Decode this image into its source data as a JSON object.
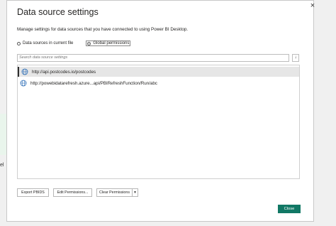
{
  "background": {
    "partial_text": "el"
  },
  "dialog": {
    "title": "Data source settings",
    "description": "Manage settings for data sources that you have connected to using Power BI Desktop.",
    "close_icon": "×",
    "scope_options": [
      {
        "label": "Data sources in current file",
        "selected": false
      },
      {
        "label": "Global permissions",
        "selected": true
      }
    ],
    "search": {
      "placeholder": "Search data source settings",
      "sort_icon": "↓"
    },
    "sources": [
      {
        "url": "http://api.postcodes.io/postcodes",
        "selected": true,
        "icon": "globe-icon"
      },
      {
        "url": "http://powebidatarefresh.azure...api/PBIRefreshFunction/Run/abc",
        "selected": false,
        "icon": "globe-icon"
      }
    ],
    "buttons": {
      "export": "Export PBIDS",
      "edit": "Edit Permissions...",
      "clear": "Clear Permissions",
      "clear_dropdown_icon": "▾",
      "close": "Close"
    },
    "colors": {
      "primary": "#117865",
      "selected_row": "#e6e6e6"
    }
  }
}
